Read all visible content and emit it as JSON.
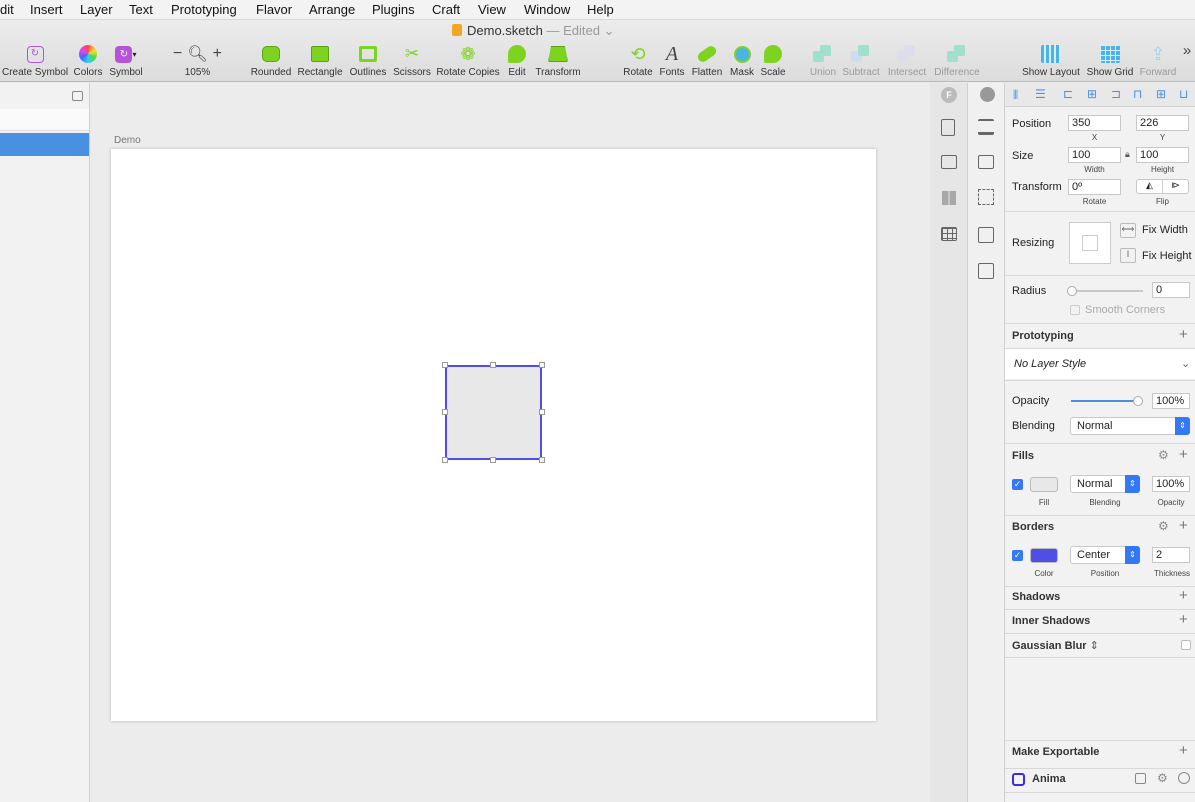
{
  "menubar": {
    "items": [
      "dit",
      "Insert",
      "Layer",
      "Text",
      "Prototyping",
      "Flavor",
      "Arrange",
      "Plugins",
      "Craft",
      "View",
      "Window",
      "Help"
    ]
  },
  "window": {
    "title": "Demo.sketch",
    "status": "— Edited"
  },
  "toolbar": {
    "create_symbol": "Create Symbol",
    "colors": "Colors",
    "symbol": "Symbol",
    "zoom_minus": "−",
    "zoom_plus": "+",
    "zoom": "105%",
    "rounded": "Rounded",
    "rectangle": "Rectangle",
    "outlines": "Outlines",
    "scissors": "Scissors",
    "rotate_copies": "Rotate Copies",
    "edit": "Edit",
    "transform": "Transform",
    "rotate": "Rotate",
    "fonts": "Fonts",
    "flatten": "Flatten",
    "mask": "Mask",
    "scale": "Scale",
    "union": "Union",
    "subtract": "Subtract",
    "intersect": "Intersect",
    "difference": "Difference",
    "show_layout": "Show Layout",
    "show_grid": "Show Grid",
    "forward": "Forward",
    "more": "»"
  },
  "canvas": {
    "artboard_name": "Demo"
  },
  "inspector": {
    "position": {
      "label": "Position",
      "x": "350",
      "y": "226",
      "x_label": "X",
      "y_label": "Y"
    },
    "size": {
      "label": "Size",
      "width": "100",
      "height": "100",
      "width_label": "Width",
      "height_label": "Height"
    },
    "transform": {
      "label": "Transform",
      "rotate": "0º",
      "rotate_label": "Rotate",
      "flip_label": "Flip"
    },
    "resizing": {
      "label": "Resizing",
      "fix_width": "Fix Width",
      "fix_height": "Fix Height"
    },
    "radius": {
      "label": "Radius",
      "value": "0",
      "smooth": "Smooth Corners"
    },
    "prototyping": "Prototyping",
    "layer_style": "No Layer Style",
    "opacity": {
      "label": "Opacity",
      "value": "100%",
      "level": 1.0
    },
    "blending": {
      "label": "Blending",
      "value": "Normal"
    },
    "fills": {
      "title": "Fills",
      "blending": "Normal",
      "opacity": "100%",
      "fill_label": "Fill",
      "blending_label": "Blending",
      "opacity_label": "Opacity",
      "color": "#e8e8e8"
    },
    "borders": {
      "title": "Borders",
      "position": "Center",
      "thickness": "2",
      "color_label": "Color",
      "position_label": "Position",
      "thickness_label": "Thickness",
      "color": "#4f4fe6"
    },
    "shadows": "Shadows",
    "inner_shadows": "Inner Shadows",
    "gaussian_blur": "Gaussian Blur",
    "make_exportable": "Make Exportable",
    "anima": "Anima"
  }
}
